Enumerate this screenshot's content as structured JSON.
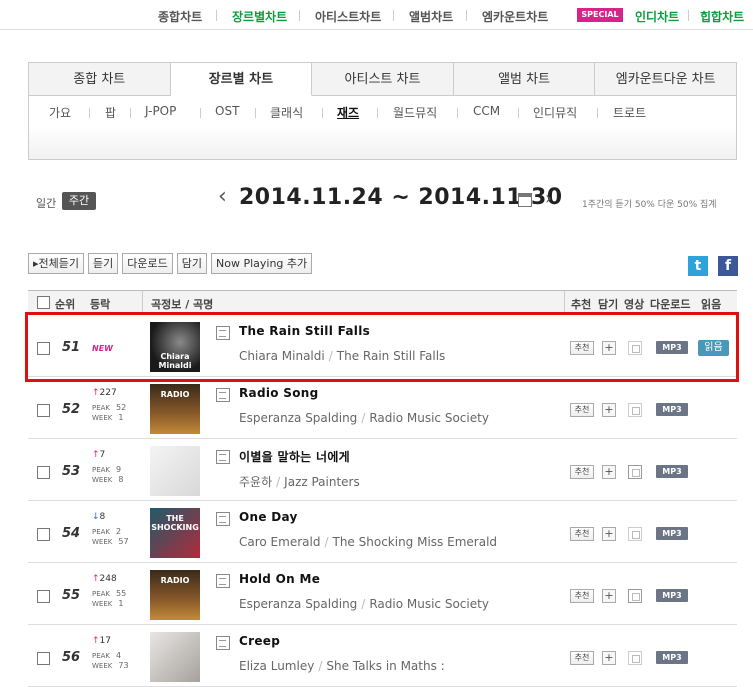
{
  "gnb": {
    "items": [
      "종합차트",
      "장르별차트",
      "아티스트차트",
      "앨범차트",
      "엠카운트차트"
    ],
    "special_badge": "SPECIAL",
    "special_items": [
      "인디차트",
      "힙합차트"
    ]
  },
  "tabs": [
    "종합 차트",
    "장르별 차트",
    "아티스트 차트",
    "앨범 차트",
    "엠카운트다운 차트"
  ],
  "subtabs": [
    "가요",
    "팝",
    "J-POP",
    "OST",
    "클래식",
    "재즈",
    "월드뮤직",
    "CCM",
    "인디뮤직",
    "트로트"
  ],
  "period": {
    "daily": "일간",
    "weekly": "주간"
  },
  "date_range": "2014.11.24 ~ 2014.11.30",
  "note": "1주간의 듣기 50% 다운 50% 집계",
  "actions": [
    "전체듣기",
    "듣기",
    "다운로드",
    "담기",
    "Now Playing 추가"
  ],
  "social": {
    "twitter": "t",
    "facebook": "f"
  },
  "table_header": {
    "rank": "순위",
    "change": "등락",
    "song": "곡정보 / 곡명",
    "recommend": "추천",
    "add": "담기",
    "video": "영상",
    "download": "다운로드",
    "listen": "읽음"
  },
  "peak_label": "PEAK",
  "week_label": "WEEK",
  "rows": [
    {
      "rank": "51",
      "new": "NEW",
      "title": "The Rain Still Falls",
      "artist": "Chiara Minaldi",
      "album": "The Rain Still Falls",
      "rec": "추천",
      "mp3": "MP3",
      "listen": "읽음",
      "art_text": "Chiara Minaldi"
    },
    {
      "rank": "52",
      "change": "227",
      "dir": "up",
      "peak": "52",
      "week": "1",
      "title": "Radio Song",
      "artist": "Esperanza Spalding",
      "album": "Radio Music Society",
      "rec": "추천",
      "mp3": "MP3",
      "art_text": "RADIO"
    },
    {
      "rank": "53",
      "change": "7",
      "dir": "up",
      "peak": "9",
      "week": "8",
      "title": "이별을 말하는 너에게",
      "artist": "주윤하",
      "album": "Jazz Painters",
      "rec": "추천",
      "mp3": "MP3",
      "art_text": ""
    },
    {
      "rank": "54",
      "change": "8",
      "dir": "down",
      "peak": "2",
      "week": "57",
      "title": "One Day",
      "artist": "Caro Emerald",
      "album": "The Shocking Miss Emerald",
      "rec": "추천",
      "mp3": "MP3",
      "art_text": "THE SHOCKING"
    },
    {
      "rank": "55",
      "change": "248",
      "dir": "up",
      "peak": "55",
      "week": "1",
      "title": "Hold On Me",
      "artist": "Esperanza Spalding",
      "album": "Radio Music Society",
      "rec": "추천",
      "mp3": "MP3",
      "art_text": "RADIO"
    },
    {
      "rank": "56",
      "change": "17",
      "dir": "up",
      "peak": "4",
      "week": "73",
      "title": "Creep",
      "artist": "Eliza Lumley",
      "album": "She Talks in Maths :",
      "rec": "추천",
      "mp3": "MP3",
      "art_text": ""
    }
  ],
  "colors": {
    "accent_green": "#0a9d3c",
    "special_pink": "#d6248b",
    "highlight_red": "#e01010",
    "mp3_gray": "#6b7585",
    "listen_blue": "#4a98b8"
  }
}
